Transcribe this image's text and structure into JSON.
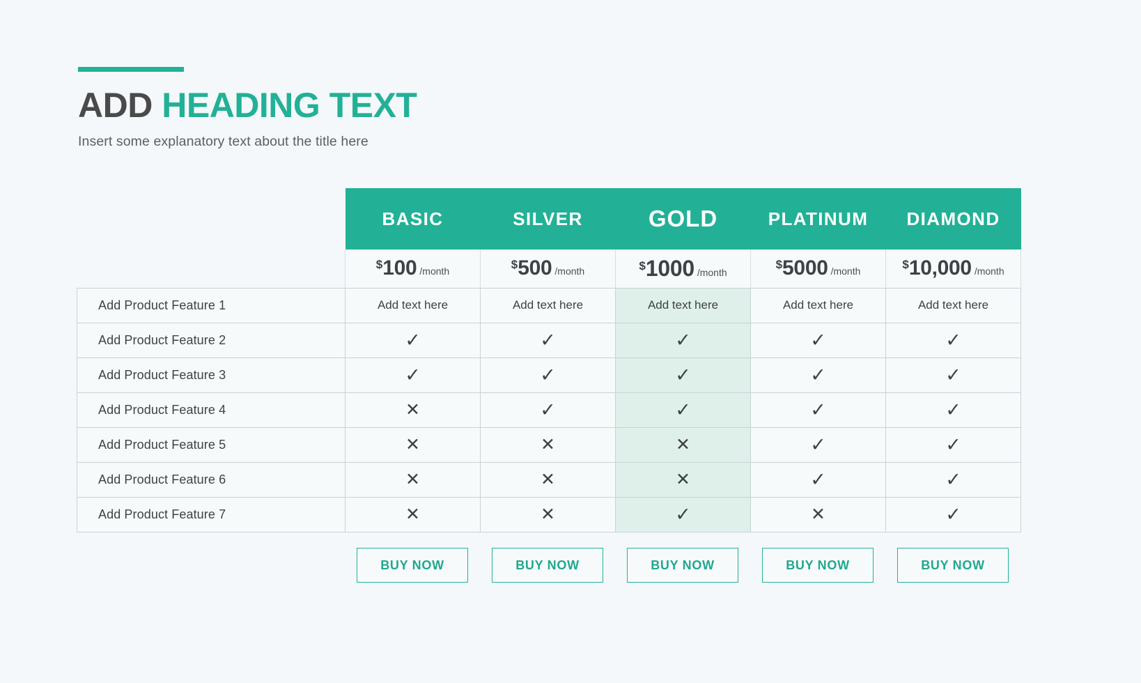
{
  "header": {
    "title_part1": "ADD",
    "title_part2": "HEADING TEXT",
    "subtitle": "Insert some explanatory text about the title here"
  },
  "colors": {
    "accent": "#22b196",
    "background": "#f4f8fa",
    "cell_background": "#f7fafb",
    "highlight_column": "#dff0ea",
    "text_dark": "#3d4246",
    "border": "#c9d1d6"
  },
  "table": {
    "tiers": [
      {
        "name": "BASIC",
        "currency": "$",
        "amount": "100",
        "period": "/month",
        "highlighted": false
      },
      {
        "name": "SILVER",
        "currency": "$",
        "amount": "500",
        "period": "/month",
        "highlighted": false
      },
      {
        "name": "GOLD",
        "currency": "$",
        "amount": "1000",
        "period": "/month",
        "highlighted": true
      },
      {
        "name": "PLATINUM",
        "currency": "$",
        "amount": "5000",
        "period": "/month",
        "highlighted": false
      },
      {
        "name": "DIAMOND",
        "currency": "$",
        "amount": "10,000",
        "period": "/month",
        "highlighted": false
      }
    ],
    "rows": [
      {
        "feature": "Add Product Feature 1",
        "type": "text",
        "values": [
          "Add text here",
          "Add text here",
          "Add text here",
          "Add text here",
          "Add text here"
        ]
      },
      {
        "feature": "Add Product Feature 2",
        "type": "mark",
        "values": [
          "check",
          "check",
          "check",
          "check",
          "check"
        ]
      },
      {
        "feature": "Add Product Feature 3",
        "type": "mark",
        "values": [
          "check",
          "check",
          "check",
          "check",
          "check"
        ]
      },
      {
        "feature": "Add Product Feature 4",
        "type": "mark",
        "values": [
          "cross",
          "check",
          "check",
          "check",
          "check"
        ]
      },
      {
        "feature": "Add Product Feature 5",
        "type": "mark",
        "values": [
          "cross",
          "cross",
          "cross",
          "check",
          "check"
        ]
      },
      {
        "feature": "Add Product Feature 6",
        "type": "mark",
        "values": [
          "cross",
          "cross",
          "cross",
          "check",
          "check"
        ]
      },
      {
        "feature": "Add Product Feature 7",
        "type": "mark",
        "values": [
          "cross",
          "cross",
          "check",
          "cross",
          "check"
        ]
      }
    ],
    "glyphs": {
      "check": "✓",
      "cross": "✕"
    }
  },
  "actions": {
    "buy_labels": [
      "BUY NOW",
      "BUY NOW",
      "BUY NOW",
      "BUY NOW",
      "BUY NOW"
    ]
  }
}
